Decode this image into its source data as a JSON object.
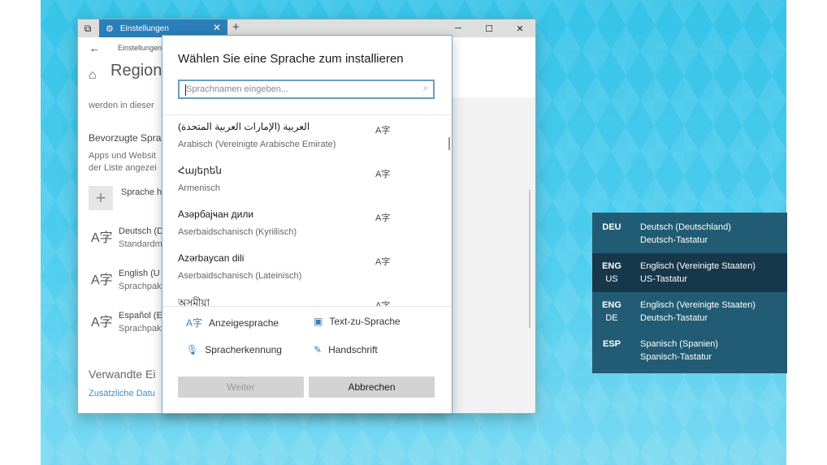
{
  "settings": {
    "tab_title": "Einstellungen",
    "window_controls": {
      "minimize": "─",
      "maximize": "☐",
      "close": "✕"
    },
    "new_tab": "+",
    "breadcrumb": "Einstellungen",
    "page_title": "Region",
    "desc": "werden in dieser",
    "preferred_heading": "Bevorzugte Sprac",
    "apps_text_1": "Apps und Websit",
    "apps_text_2": "der Liste angezei",
    "add_language": "Sprache h",
    "languages": [
      {
        "name": "Deutsch (D",
        "sub": "Standardm"
      },
      {
        "name": "English (U",
        "sub": "Sprachpak"
      },
      {
        "name": "Español (E",
        "sub": "Sprachpak"
      }
    ],
    "related_heading": "Verwandte Ei",
    "related_link": "Zusätzliche Datu"
  },
  "dialog": {
    "title": "Wählen Sie eine Sprache zum installieren",
    "search_placeholder": "Sprachnamen eingeben...",
    "items": [
      {
        "native": "العربية (الإمارات العربية المتحدة)",
        "german": "Arabisch (Vereinigte Arabische Emirate)"
      },
      {
        "native": "Հայերեն",
        "german": "Armenisch"
      },
      {
        "native": "Азәрбајҹан дили",
        "german": "Aserbaidschanisch (Kyrillisch)"
      },
      {
        "native": "Azərbaycan dili",
        "german": "Aserbaidschanisch (Lateinisch)"
      },
      {
        "native": "অসমীয়া",
        "german": ""
      }
    ],
    "features": {
      "display": "Anzeigesprache",
      "tts": "Text-zu-Sprache",
      "speech": "Spracherkennung",
      "handwriting": "Handschrift"
    },
    "next": "Weiter",
    "cancel": "Abbrechen"
  },
  "input_flyout": [
    {
      "code": "DEU",
      "sub": "",
      "language": "Deutsch (Deutschland)",
      "keyboard": "Deutsch-Tastatur",
      "selected": false
    },
    {
      "code": "ENG",
      "sub": "US",
      "language": "Englisch (Vereinigte Staaten)",
      "keyboard": "US-Tastatur",
      "selected": true
    },
    {
      "code": "ENG",
      "sub": "DE",
      "language": "Englisch (Vereinigte Staaten)",
      "keyboard": "Deutsch-Tastatur",
      "selected": false
    },
    {
      "code": "ESP",
      "sub": "",
      "language": "Spanisch (Spanien)",
      "keyboard": "Spanisch-Tastatur",
      "selected": false
    }
  ],
  "colors": {
    "accent": "#2b7fb8",
    "flyout_bg": "#215c74",
    "flyout_selected": "#17384a",
    "desktop": "#35c3e8"
  }
}
